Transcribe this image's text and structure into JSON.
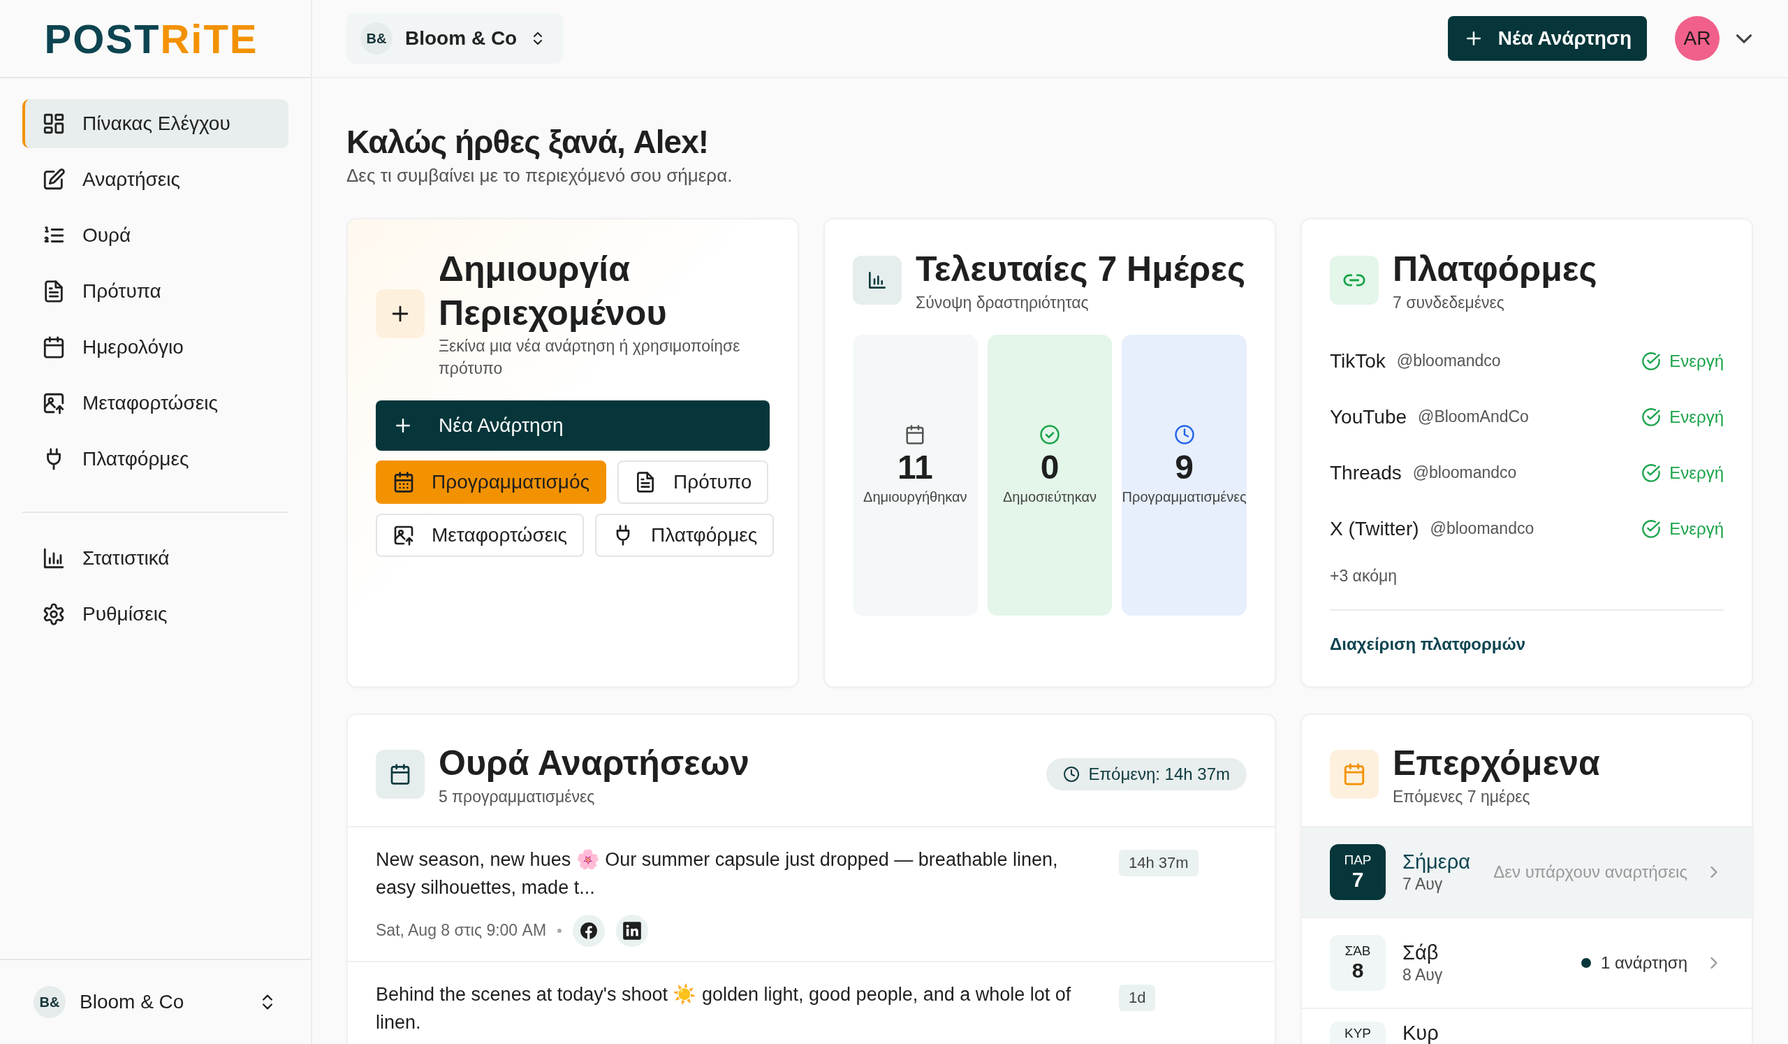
{
  "logo": {
    "text": "POST",
    "accent": "RiTE"
  },
  "sidebar": {
    "items": [
      {
        "label": "Πίνακας Ελέγχου",
        "kind": "dashboard",
        "selected": true
      },
      {
        "label": "Αναρτήσεις",
        "kind": "edit",
        "selected": false
      },
      {
        "label": "Ουρά",
        "kind": "queue",
        "selected": false
      },
      {
        "label": "Πρότυπα",
        "kind": "document",
        "selected": false
      },
      {
        "label": "Ημερολόγιο",
        "kind": "calendar",
        "selected": false
      },
      {
        "label": "Μεταφορτώσεις",
        "kind": "upload",
        "selected": false
      },
      {
        "label": "Πλατφόρμες",
        "kind": "plug",
        "selected": false
      }
    ],
    "secondary_items": [
      {
        "label": "Στατιστικά",
        "kind": "chart",
        "selected": false
      },
      {
        "label": "Ρυθμίσεις",
        "kind": "gear",
        "selected": false
      }
    ],
    "workspace": {
      "initials": "B&",
      "name": "Bloom & Co"
    }
  },
  "header": {
    "workspace": {
      "initials": "B&",
      "name": "Bloom & Co"
    },
    "new_post_button": "Νέα Ανάρτηση",
    "avatar": "AR"
  },
  "welcome": {
    "title": "Καλώς ήρθες ξανά, Alex!",
    "subtitle": "Δες τι συμβαίνει με το περιεχόμενό σου σήμερα."
  },
  "create_card": {
    "title": "Δημιουργία Περιεχομένου",
    "subtitle": "Ξεκίνα μια νέα ανάρτηση ή χρησιμοποίησε πρότυπο",
    "actions": [
      {
        "label": "Νέα Ανάρτηση",
        "kind": "primary"
      },
      {
        "label": "Προγραμματισμός",
        "kind": "accent"
      },
      {
        "label": "Πρότυπο",
        "kind": "outline"
      },
      {
        "label": "Μεταφορτώσεις",
        "kind": "outline"
      },
      {
        "label": "Πλατφόρμες",
        "kind": "outline"
      }
    ]
  },
  "stats_card": {
    "title": "Τελευταίες 7 Ημέρες",
    "subtitle": "Σύνοψη δραστηριότητας",
    "stats": [
      {
        "value": "11",
        "label": "Δημιουργήθηκαν",
        "kind": "created"
      },
      {
        "value": "0",
        "label": "Δημοσιεύτηκαν",
        "kind": "published"
      },
      {
        "value": "9",
        "label": "Προγραμματισμένες",
        "kind": "scheduled"
      }
    ]
  },
  "platforms_card": {
    "title": "Πλατφόρμες",
    "subtitle": "7 συνδεδεμένες",
    "platforms": [
      {
        "name": "TikTok",
        "handle": "@bloomandco",
        "status": "Ενεργή",
        "active": true
      },
      {
        "name": "YouTube",
        "handle": "@BloomAndCo",
        "status": "Ενεργή",
        "active": true
      },
      {
        "name": "Threads",
        "handle": "@bloomandco",
        "status": "Ενεργή",
        "active": true
      },
      {
        "name": "X (Twitter)",
        "handle": "@bloomandco",
        "status": "Ενεργή",
        "active": true
      }
    ],
    "more": "+3 ακόμη",
    "manage_link": "Διαχείριση πλατφορμών"
  },
  "queue_card": {
    "title": "Ουρά Αναρτήσεων",
    "subtitle": "5 προγραμματισμένες",
    "next_badge": "Επόμενη: 14h 37m",
    "posts": [
      {
        "text": "New season, new hues 🌸  Our summer capsule just dropped — breathable linen, easy silhouettes, made t...",
        "badge": "14h 37m",
        "meta": "Sat, Aug 8 στις 9:00 AM",
        "networks": [
          {
            "kind": "facebook"
          },
          {
            "kind": "linkedin"
          }
        ]
      },
      {
        "text": "Behind the scenes at today's shoot ☀️  golden light, good people, and a whole lot of linen.",
        "badge": "1d"
      }
    ]
  },
  "upcoming_card": {
    "title": "Επερχόμενα",
    "subtitle": "Επόμενες 7 ημέρες",
    "days": [
      {
        "weekday": "ΠΑΡ",
        "day": "7",
        "label": "Σήμερα",
        "date": "7 Αυγ",
        "info": "Δεν υπάρχουν αναρτήσεις",
        "kind": "empty",
        "selected": true
      },
      {
        "weekday": "ΣΆΒ",
        "day": "8",
        "label": "Σάβ",
        "date": "8 Αυγ",
        "info": "1 ανάρτηση",
        "kind": "posts",
        "selected": false
      },
      {
        "weekday": "ΚΥΡ",
        "label": "Κυρ",
        "selected": false
      }
    ]
  }
}
